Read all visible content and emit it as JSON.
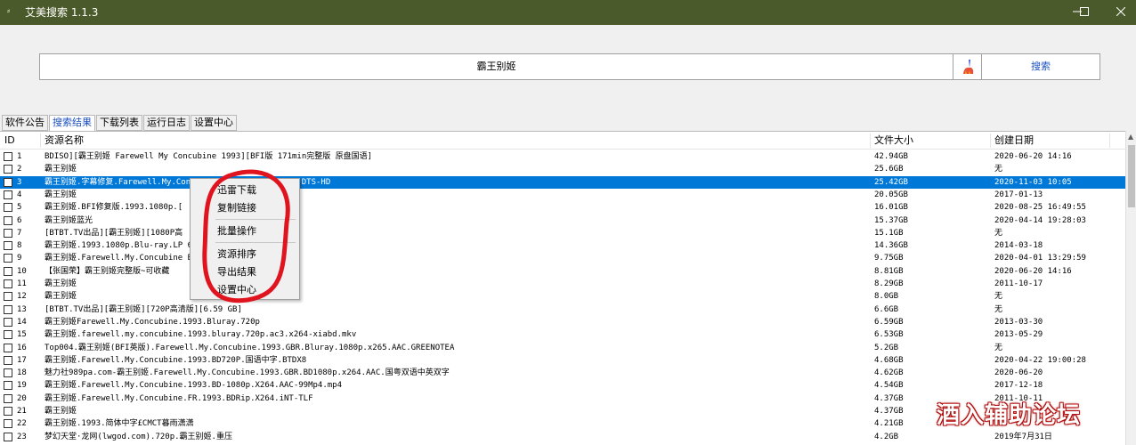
{
  "window": {
    "title": "艾美搜索 1.1.3",
    "icon": "app-icon",
    "controls": [
      "minimize",
      "maximize",
      "close"
    ],
    "title_bar_color": "#4b5a2a"
  },
  "search": {
    "query": "霸王别姬",
    "button_label": "搜索",
    "accent": "#1a4fc0"
  },
  "tabs": [
    {
      "label": "软件公告",
      "active": false
    },
    {
      "label": "搜索结果",
      "active": true
    },
    {
      "label": "下载列表",
      "active": false
    },
    {
      "label": "运行日志",
      "active": false
    },
    {
      "label": "设置中心",
      "active": false
    }
  ],
  "table": {
    "headers": {
      "id": "ID",
      "name": "资源名称",
      "size": "文件大小",
      "date": "创建日期"
    },
    "selected_row": 3,
    "selection_color": "#0078d7",
    "rows": [
      {
        "id": "1",
        "name": "BDISO][霸王别姬 Farewell My Concubine 1993][BFI版 171min完整版 原盘国语]",
        "size": "42.94GB",
        "date": "2020-06-20 14:16"
      },
      {
        "id": "2",
        "name": "霸王别姬",
        "size": "25.6GB",
        "date": "无"
      },
      {
        "id": "3",
        "name": "霸王别姬.字幕修复.Farewell.My.Concubine.1993.1080P.X264.DTS-HD",
        "size": "25.42GB",
        "date": "2020-11-03 10:05"
      },
      {
        "id": "4",
        "name": "霸王别姬",
        "size": "20.05GB",
        "date": "2017-01-13"
      },
      {
        "id": "5",
        "name": "霸王别姬.BFI修复版.1993.1080p.[",
        "size": "16.01GB",
        "date": "2020-08-25 16:49:55"
      },
      {
        "id": "6",
        "name": "霸王别姬蓝光",
        "size": "15.37GB",
        "date": "2020-04-14 19:28:03"
      },
      {
        "id": "7",
        "name": "[BTBT.TV出品][霸王别姬][1080P高",
        "size": "15.1GB",
        "date": "无"
      },
      {
        "id": "8",
        "name": "霸王别姬.1993.1080p.Blu-ray.LP                     6",
        "size": "14.36GB",
        "date": "2014-03-18"
      },
      {
        "id": "9",
        "name": "霸王别姬.Farewell.My.Concubine                     BTDX8",
        "size": "9.75GB",
        "date": "2020-04-01 13:29:59"
      },
      {
        "id": "10",
        "name": "【张国荣】霸王别姬完整版~可收藏",
        "size": "8.81GB",
        "date": "2020-06-20 14:16"
      },
      {
        "id": "11",
        "name": "霸王别姬",
        "size": "8.29GB",
        "date": "2011-10-17"
      },
      {
        "id": "12",
        "name": "霸王别姬",
        "size": "8.0GB",
        "date": "无"
      },
      {
        "id": "13",
        "name": "[BTBT.TV出品][霸王别姬][720P高清版][6.59 GB]",
        "size": "6.6GB",
        "date": "无"
      },
      {
        "id": "14",
        "name": "霸王别姬Farewell.My.Concubine.1993.Bluray.720p",
        "size": "6.59GB",
        "date": "2013-03-30"
      },
      {
        "id": "15",
        "name": "霸王别姬.farewell.my.concubine.1993.bluray.720p.ac3.x264-xiabd.mkv",
        "size": "6.53GB",
        "date": "2013-05-29"
      },
      {
        "id": "16",
        "name": "Top004.霸王别姬(BFI英版).Farewell.My.Concubine.1993.GBR.Bluray.1080p.x265.AAC.GREENOTEA",
        "size": "5.2GB",
        "date": "无"
      },
      {
        "id": "17",
        "name": "霸王别姬.Farewell.My.Concubine.1993.BD720P.国语中字.BTDX8",
        "size": "4.68GB",
        "date": "2020-04-22 19:00:28"
      },
      {
        "id": "18",
        "name": "魅力社989pa.com-霸王别姬.Farewell.My.Concubine.1993.GBR.BD1080p.x264.AAC.国粤双语中英双字",
        "size": "4.62GB",
        "date": "2020-06-20"
      },
      {
        "id": "19",
        "name": "霸王别姬.Farewell.My.Concubine.1993.BD-1080p.X264.AAC-99Mp4.mp4",
        "size": "4.54GB",
        "date": "2017-12-18"
      },
      {
        "id": "20",
        "name": "霸王别姬.Farewell.My.Concubine.FR.1993.BDRip.X264.iNT-TLF",
        "size": "4.37GB",
        "date": "2011-10-11"
      },
      {
        "id": "21",
        "name": "霸王别姬",
        "size": "4.37GB",
        "date": ""
      },
      {
        "id": "22",
        "name": "霸王别姬.1993.简体中字£CMCT暮雨潇潇",
        "size": "4.21GB",
        "date": ""
      },
      {
        "id": "23",
        "name": "梦幻天堂·龙网(lwgod.com).720p.霸王别姬.重压",
        "size": "4.2GB",
        "date": "2019年7月31日"
      }
    ]
  },
  "context_menu": {
    "items": [
      "迅雷下载",
      "复制链接",
      "批量操作",
      "资源排序",
      "导出结果",
      "设置中心"
    ],
    "highlight_color": "#e0141e"
  },
  "watermark": {
    "text": "酒入辅助论坛",
    "color": "#b01010"
  }
}
